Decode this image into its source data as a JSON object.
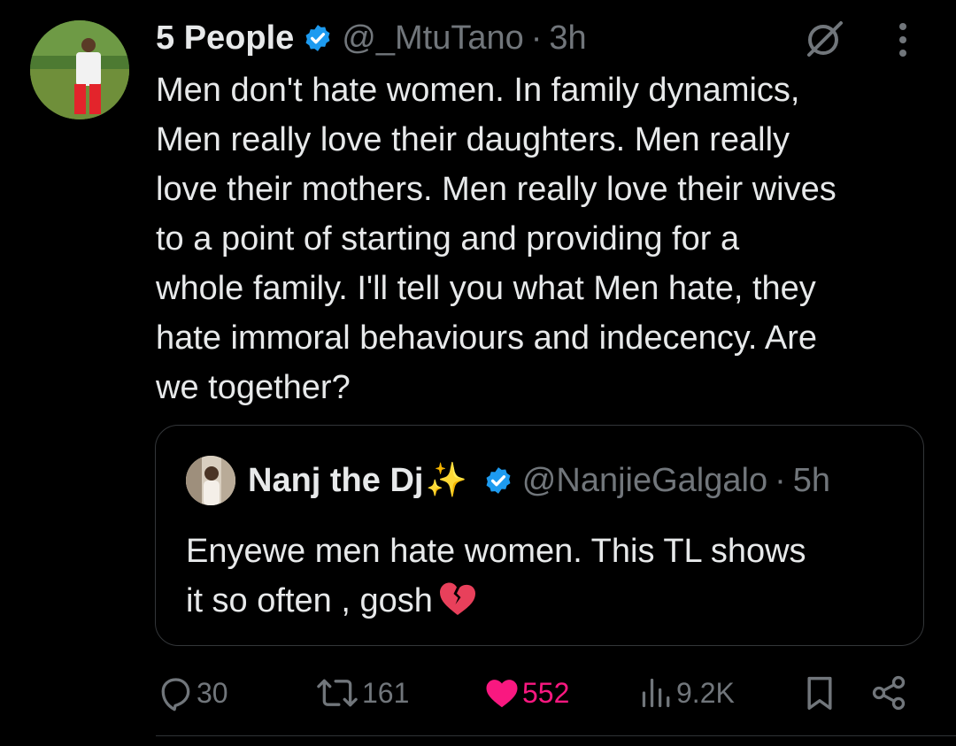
{
  "tweet": {
    "author_name": "5 People",
    "handle": "@_MtuTano",
    "separator": "·",
    "time": "3h",
    "lines": [
      "Men don't hate women. In family dynamics,",
      "Men really love their daughters. Men really",
      "love their mothers. Men really love their wives",
      "to a point of starting and providing for a",
      "whole family. I'll tell you what Men hate, they",
      "hate immoral behaviours and indecency. Are",
      "we together?"
    ]
  },
  "quote": {
    "author_name": "Nanj the Dj",
    "sparkles": "✨",
    "handle": "@NanjieGalgalo",
    "separator": "·",
    "time": "5h",
    "lines": [
      "Enyewe men hate women. This TL shows",
      "it so often , gosh"
    ]
  },
  "actions": {
    "replies": "30",
    "reposts": "161",
    "likes": "552",
    "views": "9.2K"
  },
  "icons": {
    "verified": "verified-badge-icon",
    "grok": "grok-icon",
    "more": "more-options-icon",
    "reply": "reply-icon",
    "repost": "repost-icon",
    "like": "heart-icon",
    "views": "views-icon",
    "bookmark": "bookmark-icon",
    "share": "share-icon",
    "broken_heart": "broken-heart-emoji"
  },
  "colors": {
    "background": "#000000",
    "text": "#e7e9ea",
    "muted": "#71767b",
    "verified": "#1d9bf0",
    "like": "#f91880"
  }
}
